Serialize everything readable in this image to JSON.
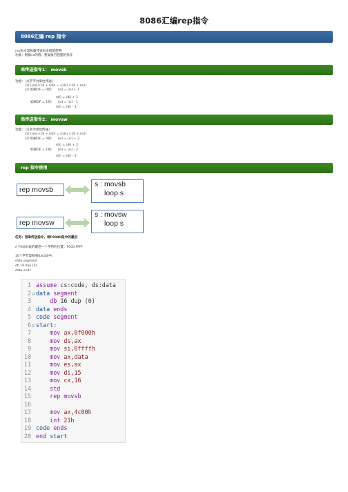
{
  "title": "8086汇编rep指令",
  "section_main": "8086汇编 rep 指令",
  "intro": [
    "rep指令常和串传送指令搭配使用",
    "功能：根据cx的值，重复执行后面的指令"
  ],
  "movsb": {
    "header": "串传送指令1：  movsb",
    "lines": [
      "功能：（以字节为单位传送）",
      "(1) ((es)×16 + (di)) = ((ds) ×16 + (si))",
      "(2) 如果DF = 0则：    (si) = (si) + 1",
      "(di) = (di) + 1",
      "如果DF = 1则：    (si) = (si) - 1",
      "(di) = (di) - 1"
    ]
  },
  "movsw": {
    "header": "串传送指令2：  movsw",
    "lines": [
      "功能：（以字为单位传送）",
      "(1) ((es)×16 + (di)) = ((ds) ×16 + (si))",
      "(2) 如果DF = 0则：    (si) = (si) + 2",
      "(di) = (di) + 2",
      "如果DF = 1则：    (si) = (si) - 2",
      "(di) = (di) - 2"
    ]
  },
  "rep_usage": {
    "header": "rep 指令使用",
    "row1_left": "rep movsb",
    "row1_right_1": "s : movsb",
    "row1_right_2": "loop s",
    "row2_left": "rep movsw",
    "row2_right_1": "s : movsw",
    "row2_right_2": "loop s"
  },
  "task": "任务：用串传送指令，将F000H段中的最后",
  "notes": [
    "// F000H段的最后一个字符的位置：F000:FFFF",
    "16个字节复制到data段中。",
    "data segment",
    "db 16 dup (0)",
    "data ends"
  ],
  "code": [
    {
      "n": "1",
      "f": "",
      "t": [
        {
          "c": "kw",
          "s": "assume "
        },
        {
          "c": "",
          "s": "cs:code, ds:data"
        }
      ]
    },
    {
      "n": "2",
      "f": "⊟",
      "t": [
        {
          "c": "lbl",
          "s": "data "
        },
        {
          "c": "kw",
          "s": "segment"
        }
      ]
    },
    {
      "n": "3",
      "f": "",
      "t": [
        {
          "c": "",
          "s": "    "
        },
        {
          "c": "kw",
          "s": "db "
        },
        {
          "c": "",
          "s": "16 dup (0)"
        }
      ]
    },
    {
      "n": "4",
      "f": "",
      "t": [
        {
          "c": "lbl",
          "s": "data "
        },
        {
          "c": "kw",
          "s": "ends"
        }
      ]
    },
    {
      "n": "5",
      "f": "",
      "t": [
        {
          "c": "lbl",
          "s": "code "
        },
        {
          "c": "kw",
          "s": "segment"
        }
      ]
    },
    {
      "n": "6",
      "f": "⊟",
      "t": [
        {
          "c": "lbl",
          "s": "start:"
        }
      ]
    },
    {
      "n": "7",
      "f": "",
      "t": [
        {
          "c": "",
          "s": "    "
        },
        {
          "c": "kw",
          "s": "mov "
        },
        {
          "c": "tx",
          "s": "ax,0f000h"
        }
      ]
    },
    {
      "n": "8",
      "f": "",
      "t": [
        {
          "c": "",
          "s": "    "
        },
        {
          "c": "kw",
          "s": "mov "
        },
        {
          "c": "tx",
          "s": "ds,ax"
        }
      ]
    },
    {
      "n": "9",
      "f": "",
      "t": [
        {
          "c": "",
          "s": "    "
        },
        {
          "c": "kw",
          "s": "mov "
        },
        {
          "c": "tx",
          "s": "si,0ffffh"
        }
      ]
    },
    {
      "n": "10",
      "f": "",
      "t": [
        {
          "c": "",
          "s": "    "
        },
        {
          "c": "kw",
          "s": "mov "
        },
        {
          "c": "tx",
          "s": "ax,data"
        }
      ]
    },
    {
      "n": "11",
      "f": "",
      "t": [
        {
          "c": "",
          "s": "    "
        },
        {
          "c": "kw",
          "s": "mov "
        },
        {
          "c": "tx",
          "s": "es,ax"
        }
      ]
    },
    {
      "n": "12",
      "f": "",
      "t": [
        {
          "c": "",
          "s": "    "
        },
        {
          "c": "kw",
          "s": "mov "
        },
        {
          "c": "tx",
          "s": "di,15"
        }
      ]
    },
    {
      "n": "13",
      "f": "",
      "t": [
        {
          "c": "",
          "s": "    "
        },
        {
          "c": "kw",
          "s": "mov "
        },
        {
          "c": "tx",
          "s": "cx,16"
        }
      ]
    },
    {
      "n": "14",
      "f": "",
      "t": [
        {
          "c": "",
          "s": "    "
        },
        {
          "c": "kw",
          "s": "std"
        }
      ]
    },
    {
      "n": "15",
      "f": "",
      "t": [
        {
          "c": "",
          "s": "    "
        },
        {
          "c": "kw",
          "s": "rep movsb"
        }
      ]
    },
    {
      "n": "16",
      "f": "",
      "t": []
    },
    {
      "n": "17",
      "f": "",
      "t": [
        {
          "c": "",
          "s": "    "
        },
        {
          "c": "kw",
          "s": "mov "
        },
        {
          "c": "tx",
          "s": "ax,4c00h"
        }
      ]
    },
    {
      "n": "18",
      "f": "",
      "t": [
        {
          "c": "",
          "s": "    "
        },
        {
          "c": "kw",
          "s": "int "
        },
        {
          "c": "tx",
          "s": "21h"
        }
      ]
    },
    {
      "n": "19",
      "f": "",
      "t": [
        {
          "c": "lbl",
          "s": "code "
        },
        {
          "c": "kw",
          "s": "ends"
        }
      ]
    },
    {
      "n": "20",
      "f": "",
      "t": [
        {
          "c": "kw",
          "s": "end "
        },
        {
          "c": "lbl",
          "s": "start"
        }
      ]
    }
  ]
}
